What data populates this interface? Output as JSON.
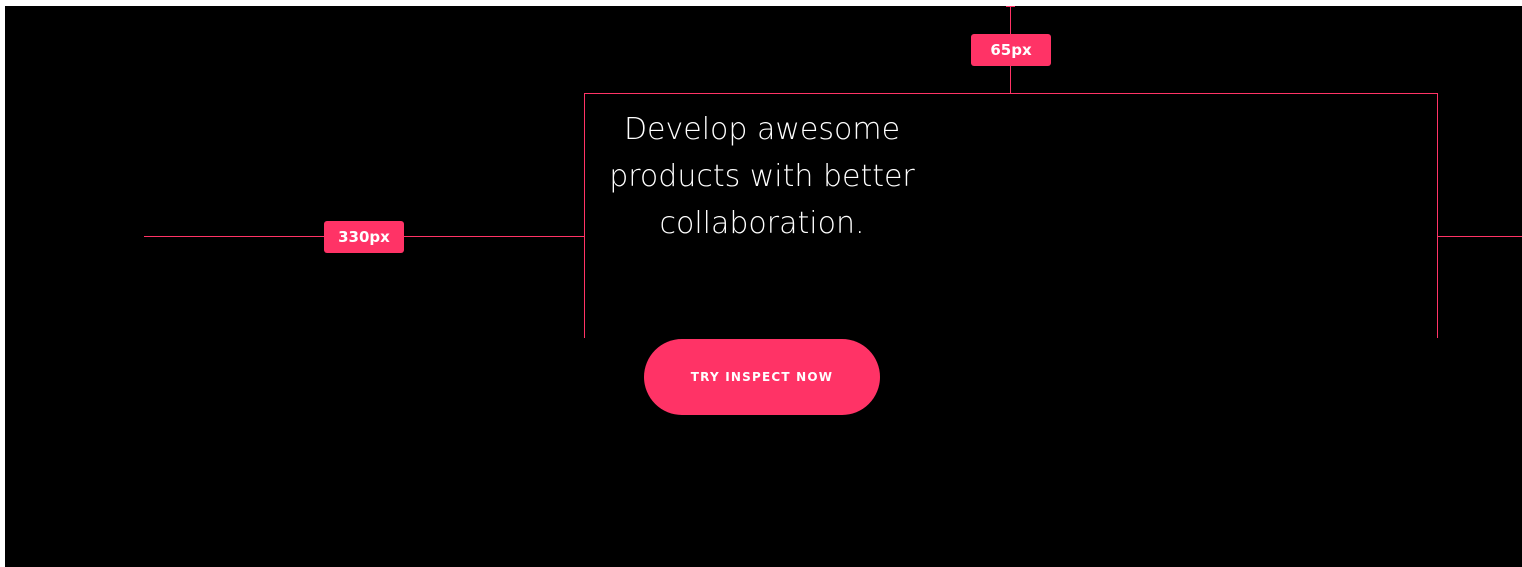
{
  "hero": {
    "headline": "Develop awesome products with better collaboration.",
    "cta_label": "TRY INSPECT NOW"
  },
  "measurements": {
    "top_spacing_label": "65px",
    "left_spacing_label": "330px"
  },
  "colors": {
    "background": "#000000",
    "accent": "#ff3366",
    "text": "#ffffff"
  }
}
